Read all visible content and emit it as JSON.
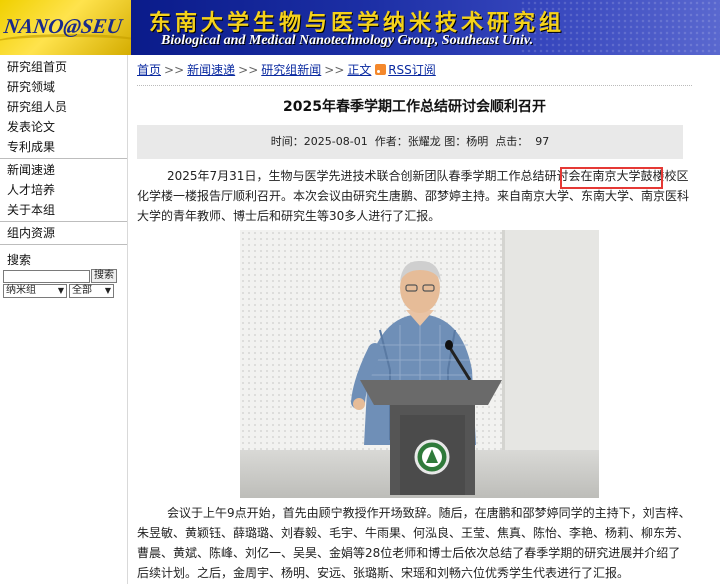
{
  "header": {
    "logo_text": "NANO@SEU",
    "title_cn": "东南大学生物与医学纳米技术研究组",
    "title_en": "Biological and Medical Nanotechnology Group, Southeast Univ."
  },
  "sidebar": {
    "items": [
      {
        "label": "研究组首页"
      },
      {
        "label": "研究领域"
      },
      {
        "label": "研究组人员"
      },
      {
        "label": "发表论文"
      },
      {
        "label": "专利成果"
      },
      {
        "label": "新闻速递"
      },
      {
        "label": "人才培养"
      },
      {
        "label": "关于本组"
      },
      {
        "label": "组内资源"
      }
    ],
    "search_heading": "搜索",
    "search_button": "搜索",
    "search_value": "",
    "scope_select": "纳米组",
    "category_select": "全部"
  },
  "breadcrumb": {
    "home": "首页",
    "news": "新闻速递",
    "group_news": "研究组新闻",
    "body": "正文",
    "rss": "RSS订阅"
  },
  "article": {
    "title": "2025年春季学期工作总结研讨会顺利召开",
    "meta": "时间：2025-08-01  作者：张耀龙 图：杨明  点击：  97",
    "para1_a": "2025年7月31日，生物与医学先进技术联合创新团队春季学期工作总结研讨会在",
    "para1_highlight": "南京大学鼓楼校区",
    "para1_b": "化学楼一楼报告厅顺利召开。本次会议由研究生唐鹏、邵梦婷主持。来自南京大学、东南大学、南京医科大学的青年教师、博士后和研究生等30多人进行了汇报。",
    "para2": "会议于上午9点开始，首先由顾宁教授作开场致辞。随后，在唐鹏和邵梦婷同学的主持下，刘吉梓、朱昱敏、黄颖钰、薛璐璐、刘春毅、毛宇、牛雨果、何泓良、王莹、焦真、陈怡、李艳、杨莉、柳东芳、曹晨、黄斌、陈峰、刘亿一、吴昊、金娟等28位老师和博士后依次总结了春季学期的研究进展并介绍了后续计划。之后，金周宇、杨明、安远、张璐斯、宋瑶和刘畅六位优秀学生代表进行了汇报。"
  },
  "colors": {
    "banner_dark": "#0a1b8a",
    "logo_yellow": "#f0d000",
    "title_yellow": "#f5d21b",
    "link_blue": "#0a2aa0",
    "highlight_red": "#e53935",
    "meta_bg": "#e9e9e9"
  },
  "icons": {
    "rss": "rss-icon",
    "podium_emblem": "university-emblem-icon"
  }
}
